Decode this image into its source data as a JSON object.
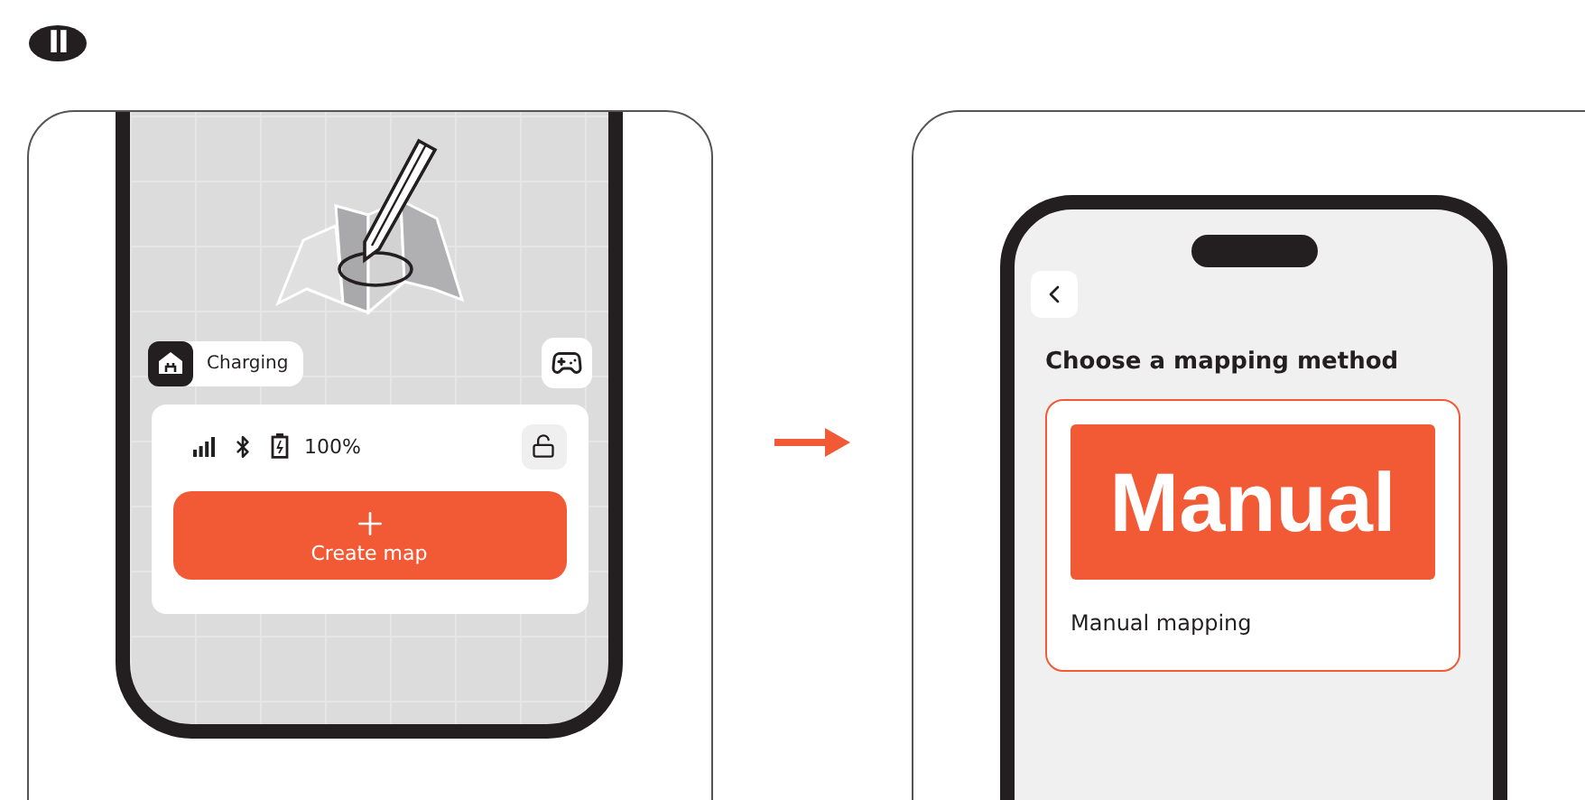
{
  "step": "II",
  "left_screen": {
    "status": "Charging",
    "battery": "100%",
    "create_button": "Create map"
  },
  "right_screen": {
    "title": "Choose a mapping method",
    "options": [
      {
        "banner": "Manual",
        "label": "Manual mapping",
        "selected": true
      }
    ]
  }
}
